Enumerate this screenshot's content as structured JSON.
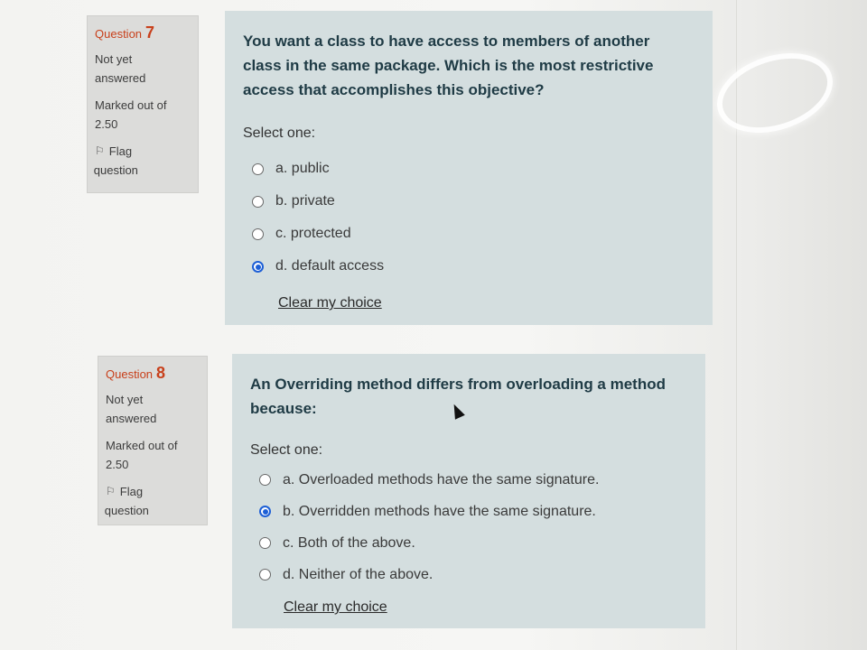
{
  "questions": [
    {
      "label": "Question",
      "number": "7",
      "state_line1": "Not yet",
      "state_line2": "answered",
      "mark_line1": "Marked out of",
      "mark_line2": "2.50",
      "flag_line1": "Flag",
      "flag_line2": "question",
      "text_line1": "You want a class to have access to members of another",
      "text_line2": "class in the same package. Which is the most restrictive",
      "text_line3": "access that accomplishes this objective?",
      "select_label": "Select one:",
      "options": [
        {
          "label": "a. public",
          "selected": false
        },
        {
          "label": "b. private",
          "selected": false
        },
        {
          "label": "c. protected",
          "selected": false
        },
        {
          "label": "d. default access",
          "selected": true
        }
      ],
      "clear_label": "Clear my choice"
    },
    {
      "label": "Question",
      "number": "8",
      "state_line1": "Not yet",
      "state_line2": "answered",
      "mark_line1": "Marked out of",
      "mark_line2": "2.50",
      "flag_line1": "Flag",
      "flag_line2": "question",
      "text_line1": "An Overriding method differs from overloading a method",
      "text_line2": "because:",
      "text_line3": "",
      "select_label": "Select one:",
      "options": [
        {
          "label": "a. Overloaded methods have the same signature.",
          "selected": false
        },
        {
          "label": "b. Overridden methods have the same signature.",
          "selected": true
        },
        {
          "label": "c. Both of the above.",
          "selected": false
        },
        {
          "label": "d. Neither of the above.",
          "selected": false
        }
      ],
      "clear_label": "Clear my choice"
    }
  ],
  "icons": {
    "flag": "flag-icon",
    "pointer": "mouse-pointer-icon"
  },
  "colors": {
    "question_number": "#c8401b",
    "selected_radio": "#1d5fd6",
    "question_panel": "#d4dedf",
    "info_panel": "#dcdcda"
  }
}
